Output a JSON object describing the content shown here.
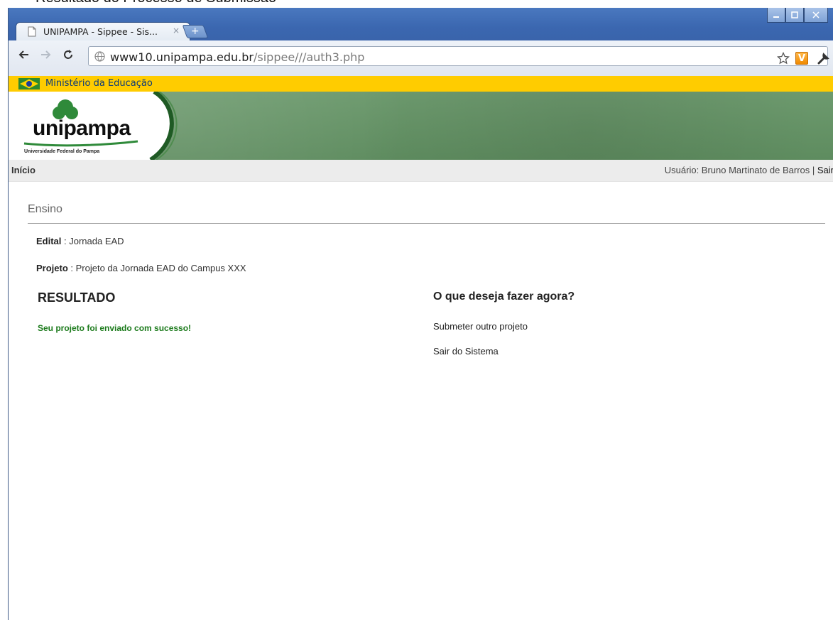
{
  "caption": "Resultado do Processo de Submissão",
  "browser": {
    "tab_title": "UNIPAMPA - Sippee - Sis...",
    "tab_close": "×",
    "new_tab": "+",
    "url_host": "www10.unipampa.edu.br",
    "url_path": "/sippee///auth3.php",
    "extension_label": "V"
  },
  "gov_bar": {
    "text": "Ministério da Educação"
  },
  "banner": {
    "logo_text": "unipampa",
    "logo_sub": "Universidade Federal do Pampa"
  },
  "nav": {
    "home": "Início",
    "user_label": "Usuário: Bruno Martinato de Barros",
    "separator": " | ",
    "logout": "Sair"
  },
  "main": {
    "section_title": "Ensino",
    "edital_label": "Edital",
    "edital_value": " : Jornada EAD",
    "projeto_label": "Projeto",
    "projeto_value": " : Projeto da Jornada EAD do Campus XXX",
    "result_heading": "RESULTADO",
    "result_message": "Seu projeto foi enviado com sucesso!",
    "next_heading": "O que deseja fazer agora?",
    "actions": [
      "Submeter outro projeto",
      "Sair do Sistema"
    ]
  },
  "colors": {
    "gov_bar": "#ffcc00",
    "banner_green": "#6d9a6e",
    "success_text": "#1b7a1b"
  }
}
